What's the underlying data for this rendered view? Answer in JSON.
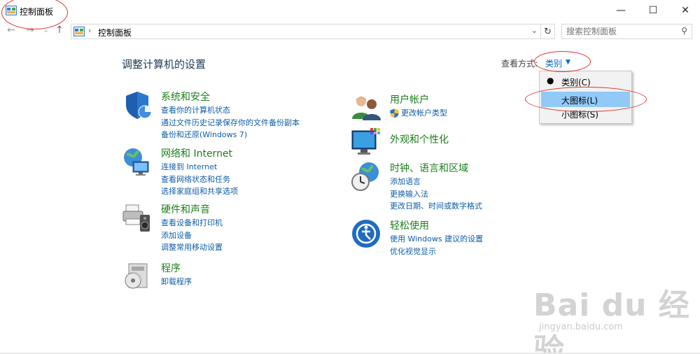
{
  "window": {
    "title": "控制面板",
    "buttons": {
      "minimize": "—",
      "maximize": "☐",
      "close": "✕"
    }
  },
  "nav": {
    "back": "←",
    "forward": "→",
    "recent": "⌄",
    "up": "↑",
    "breadcrumb_sep": "›",
    "breadcrumb": "控制面板",
    "dropdown": "⌄",
    "refresh": "↻",
    "search_placeholder": "搜索控制面板",
    "search_icon": "⚲"
  },
  "header": {
    "title": "调整计算机的设置",
    "view_by_label": "查看方式:",
    "view_by_value": "类别",
    "caret": "▼"
  },
  "categories": [
    {
      "icon": "shield-security-icon",
      "title": "系统和安全",
      "links": [
        "查看你的计算机状态",
        "通过文件历史记录保存你的文件备份副本",
        "备份和还原(Windows 7)"
      ]
    },
    {
      "icon": "network-globe-icon",
      "title": "网络和 Internet",
      "links": [
        "连接到 Internet",
        "查看网络状态和任务",
        "选择家庭组和共享选项"
      ]
    },
    {
      "icon": "printer-speaker-icon",
      "title": "硬件和声音",
      "links": [
        "查看设备和打印机",
        "添加设备",
        "调整常用移动设置"
      ]
    },
    {
      "icon": "programs-disc-icon",
      "title": "程序",
      "links": [
        "卸载程序"
      ]
    },
    {
      "icon": "users-icon",
      "title": "用户帐户",
      "links": [
        "更改帐户类型"
      ]
    },
    {
      "icon": "monitor-personalize-icon",
      "title": "外观和个性化",
      "links": []
    },
    {
      "icon": "clock-globe-icon",
      "title": "时钟、语言和区域",
      "links": [
        "添加语言",
        "更换输入法",
        "更改日期、时间或数字格式"
      ]
    },
    {
      "icon": "ease-of-access-icon",
      "title": "轻松使用",
      "links": [
        "使用 Windows 建议的设置",
        "优化视觉显示"
      ]
    }
  ],
  "menu": {
    "items": [
      {
        "label": "类别(C)",
        "selected": true,
        "bullet": "●"
      },
      {
        "label": "大图标(L)",
        "highlighted": true
      },
      {
        "label": "小图标(S)"
      }
    ]
  },
  "watermark": {
    "main": "Bai du 经验",
    "sub": "jingyan.baidu.com"
  },
  "colors": {
    "accent_link": "#0d5ca8",
    "category_title": "#1a7f1a",
    "annotation": "#e0342c",
    "menu_highlight": "#91c9f7"
  }
}
